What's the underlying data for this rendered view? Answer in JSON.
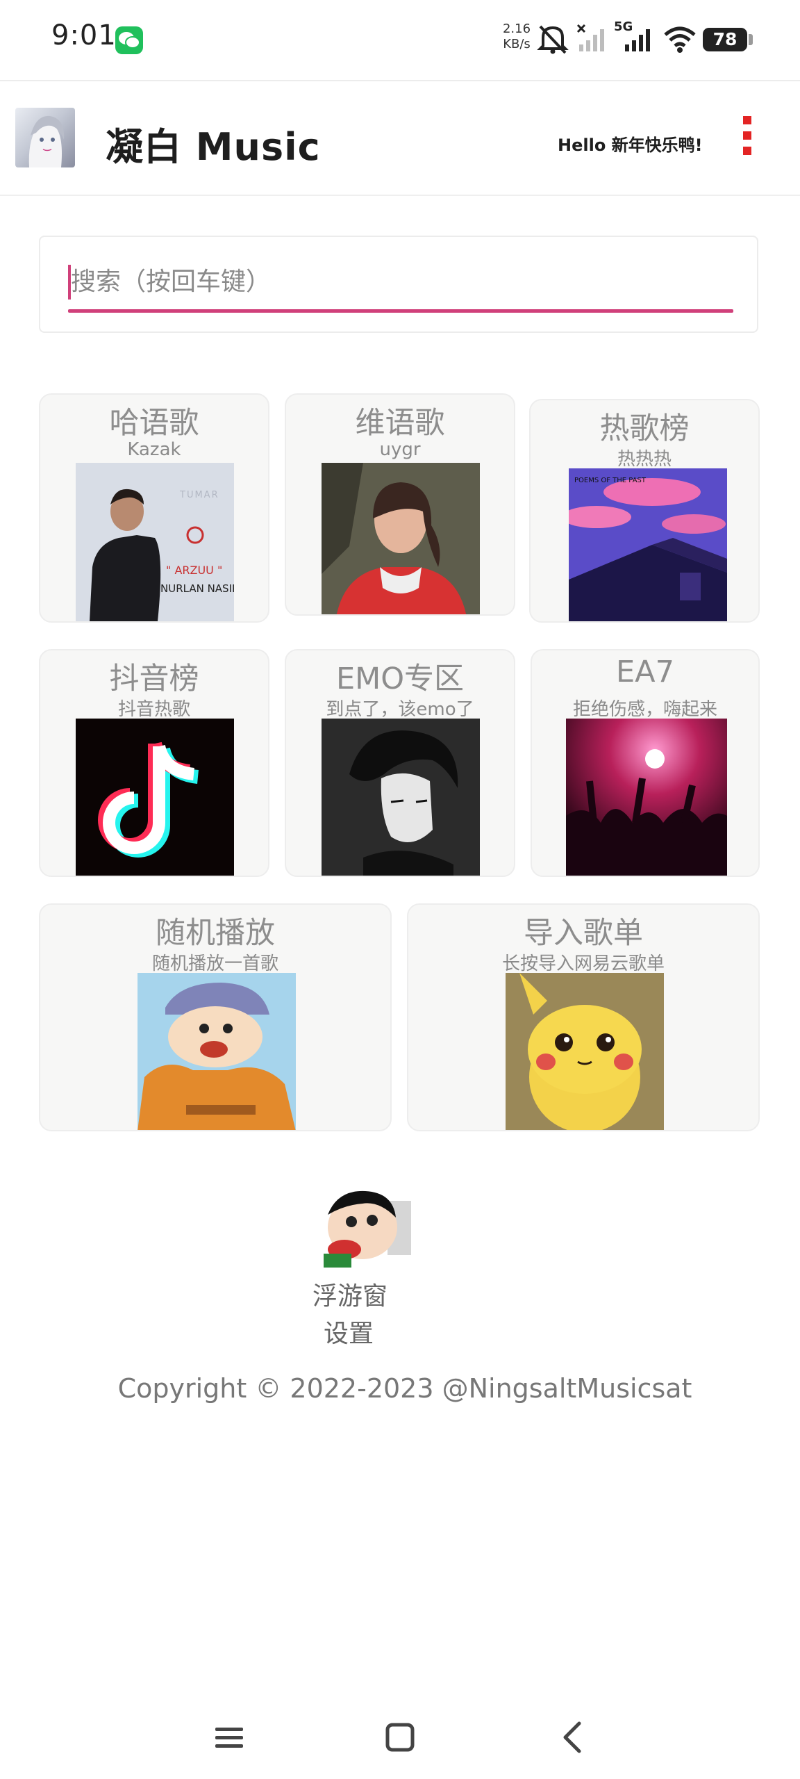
{
  "status_bar": {
    "time": "9:01",
    "net_speed_value": "2.16",
    "net_speed_unit": "KB/s",
    "network_type": "5G",
    "battery": "78",
    "icons": [
      "wechat-icon",
      "mute-bell-icon",
      "no-signal-icon",
      "signal-icon",
      "wifi-icon",
      "battery-icon"
    ]
  },
  "header": {
    "title": "凝白 Music",
    "greeting": "Hello 新年快乐鸭!",
    "accent_color": "#e32424"
  },
  "search": {
    "placeholder": "搜索（按回车键）",
    "value": "",
    "accent_color": "#d0407a"
  },
  "cards": [
    {
      "title": "哈语歌",
      "subtitle": "Kazak",
      "art": "kazak-album-art"
    },
    {
      "title": "维语歌",
      "subtitle": "uygr",
      "art": "uygr-album-art"
    },
    {
      "title": "热歌榜",
      "subtitle": "热热热",
      "art": "hot-album-art"
    },
    {
      "title": "抖音榜",
      "subtitle": "抖音热歌",
      "art": "douyin-logo-art"
    },
    {
      "title": "EMO专区",
      "subtitle": "到点了，该emo了",
      "art": "emo-art"
    },
    {
      "title": "EA7",
      "subtitle": "拒绝伤感，嗨起来",
      "art": "party-art"
    },
    {
      "title": "随机播放",
      "subtitle": "随机播放一首歌",
      "art": "crayon-shin-art"
    },
    {
      "title": "导入歌单",
      "subtitle": "长按导入网易云歌单",
      "art": "pikachu-art"
    }
  ],
  "album_text": {
    "tumar": "TUMAR",
    "song": "\" ARZUU \"",
    "artist": "NURLAN NASIP",
    "poems": "POEMS OF THE PAST"
  },
  "float_window": {
    "label": "浮游窗",
    "settings": "设置"
  },
  "footer": {
    "copyright": "Copyright © 2022-2023 @NingsaltMusicsat"
  },
  "nav_bar": {
    "icons": [
      "menu-icon",
      "home-icon",
      "back-icon"
    ]
  }
}
